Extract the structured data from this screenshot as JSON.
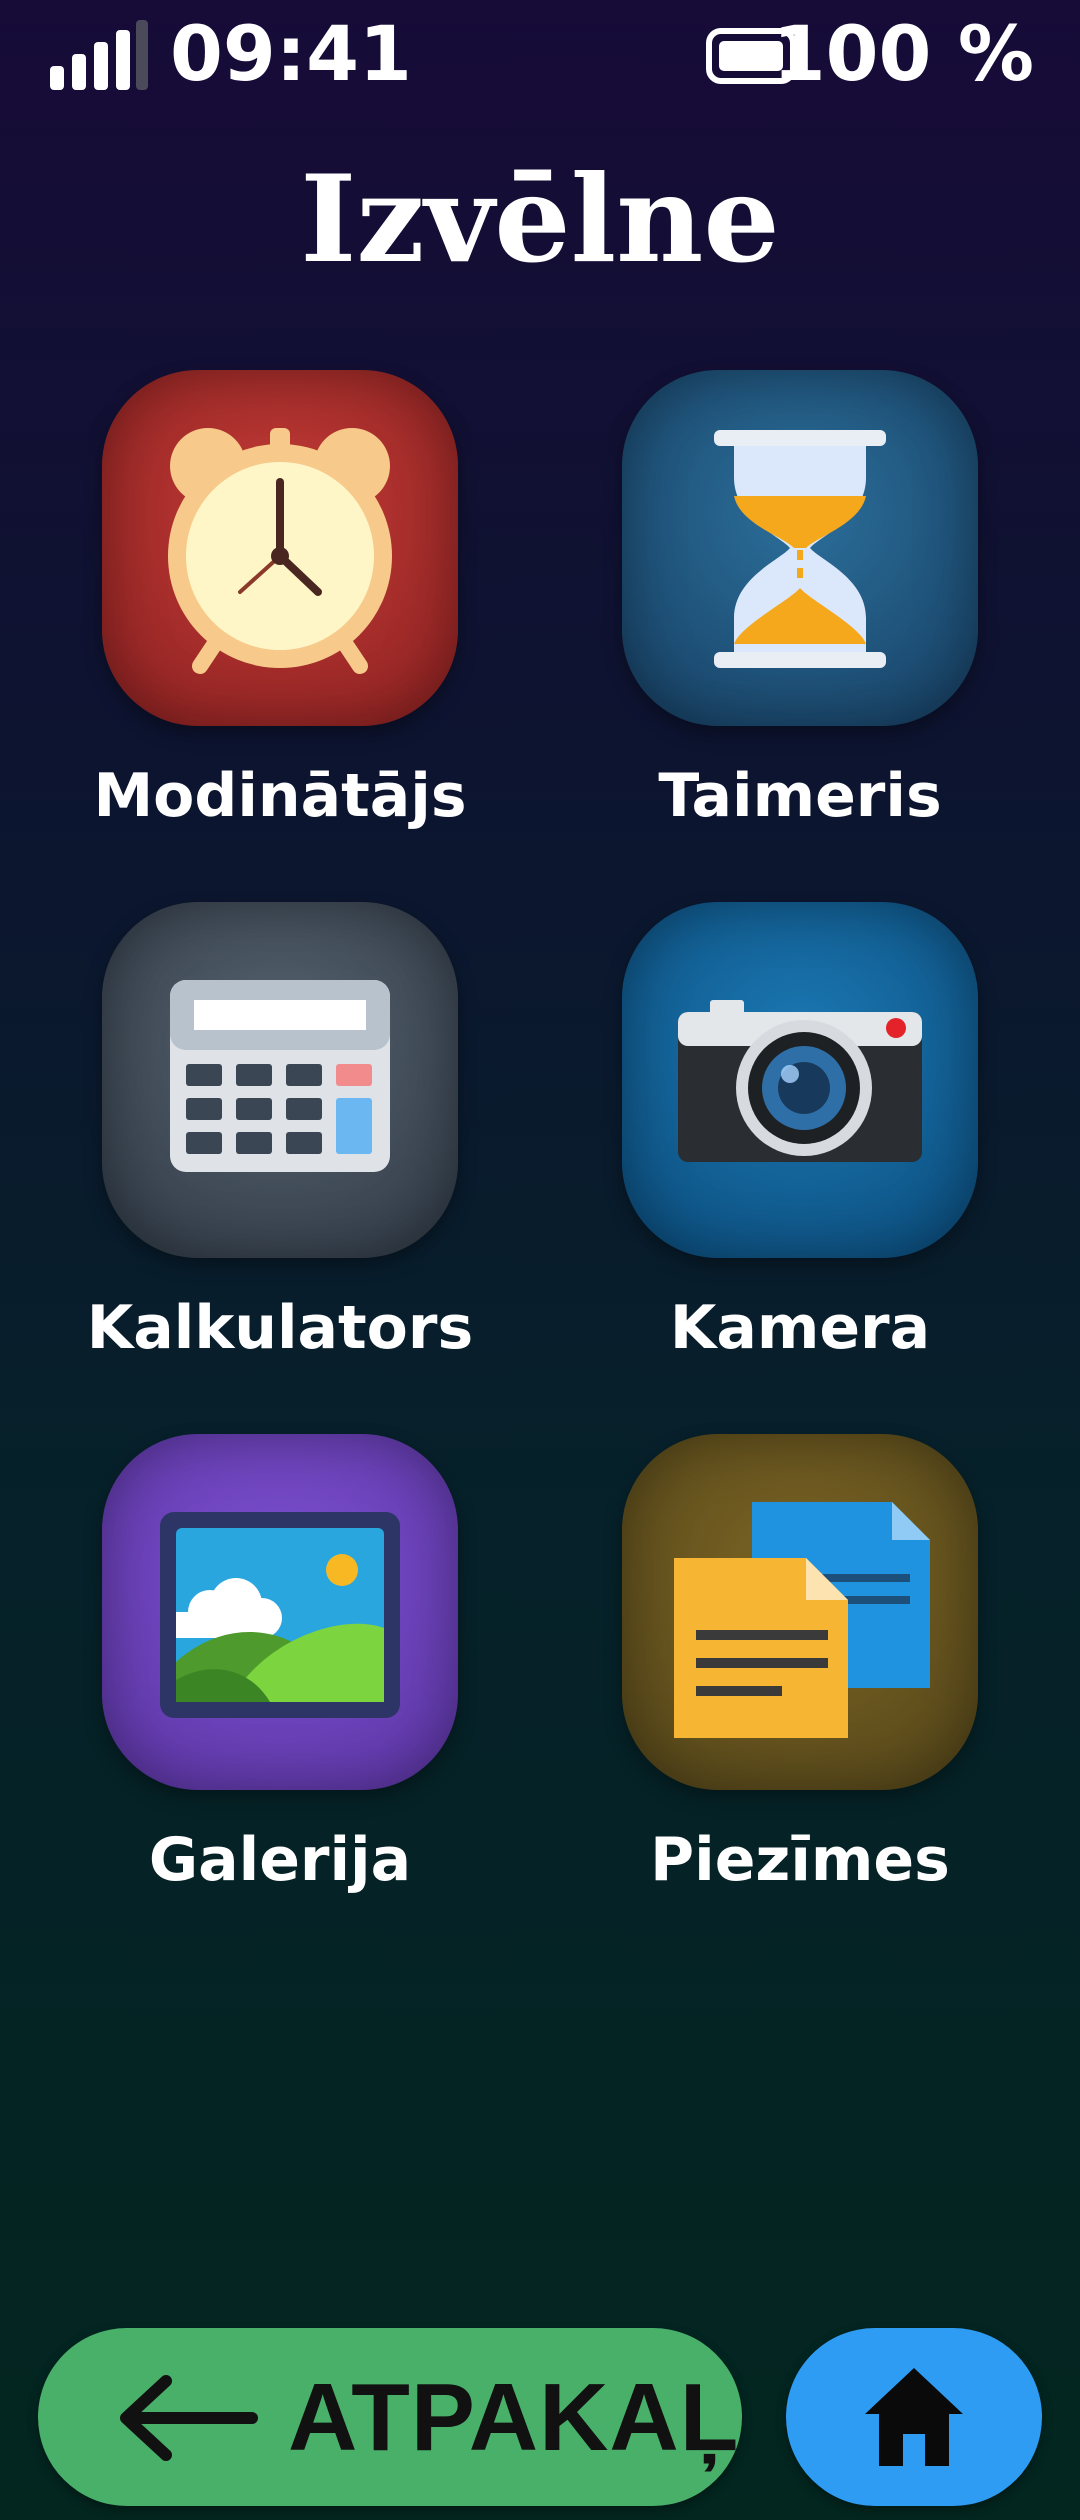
{
  "status_bar": {
    "time": "09:41",
    "battery_text": "100 %",
    "signal_icon": "signal-bars-icon",
    "battery_icon": "battery-full-icon"
  },
  "title": "Izvēlne",
  "apps": [
    {
      "label": "Modinātājs",
      "icon": "alarm-clock-icon",
      "color": "#a92d2b"
    },
    {
      "label": "Taimeris",
      "icon": "hourglass-icon",
      "color": "#1f5580"
    },
    {
      "label": "Kalkulators",
      "icon": "calculator-icon",
      "color": "#3c4753"
    },
    {
      "label": "Kamera",
      "icon": "camera-icon",
      "color": "#11609a"
    },
    {
      "label": "Galerija",
      "icon": "gallery-picture-icon",
      "color": "#6a42b8"
    },
    {
      "label": "Piezīmes",
      "icon": "notes-documents-icon",
      "color": "#64521e"
    }
  ],
  "bottom_bar": {
    "back_label": "ATPAKAĻ",
    "back_icon": "arrow-left-icon",
    "home_icon": "home-icon",
    "back_color": "#49b06a",
    "home_color": "#2f9cf4"
  }
}
